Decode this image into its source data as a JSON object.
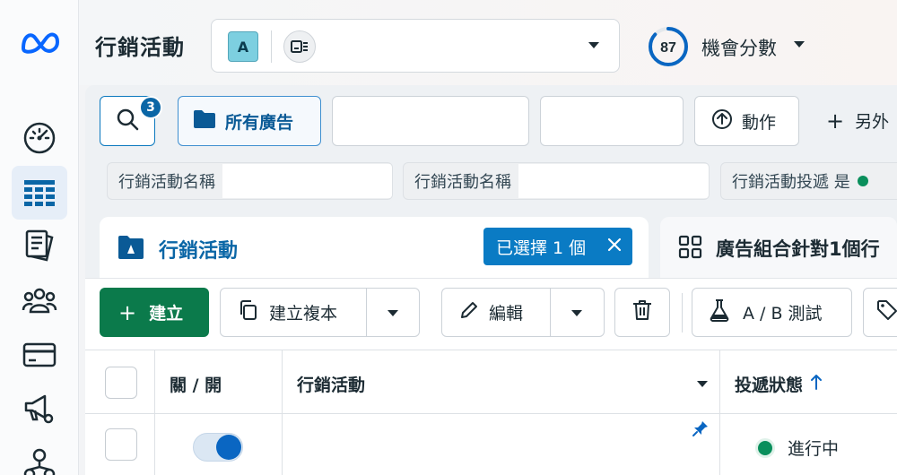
{
  "header": {
    "title": "行銷活動",
    "account_badge": "A",
    "opportunity_score": "87",
    "opportunity_label": "機會分數"
  },
  "toolbar": {
    "search_badge_count": "3",
    "all_ads_label": "所有廣告",
    "action_label": "動作",
    "more_label": "另外"
  },
  "filters": [
    {
      "label": "行銷活動名稱"
    },
    {
      "label": "行銷活動名稱"
    },
    {
      "label": "行銷活動投遞 是"
    }
  ],
  "tabs": {
    "campaign_label": "行銷活動",
    "selected_label": "已選擇 1 個",
    "adset_label": "廣告組合針對1個行"
  },
  "actions": {
    "create": "建立",
    "duplicate": "建立複本",
    "edit": "編輯",
    "ab_test": "A / B 測試"
  },
  "table": {
    "columns": [
      "關 / 開",
      "行銷活動",
      "投遞狀態"
    ],
    "rows": [
      {
        "toggle_on": true,
        "campaign": "",
        "status": "進行中"
      }
    ]
  },
  "colors": {
    "brand_blue": "#0a66a6",
    "create_green": "#0b7a4b",
    "status_green": "#0a8f5c",
    "selected_pill": "#0a7bc4"
  },
  "icons": [
    "meta-logo-icon",
    "dashboard-gauge-icon",
    "table-grid-icon",
    "pages-icon",
    "audience-icon",
    "billing-card-icon",
    "megaphone-gear-icon",
    "hierarchy-icon",
    "placement-icon",
    "search-icon",
    "folder-icon",
    "upload-icon",
    "plus-icon",
    "campaign-flag-icon",
    "close-icon",
    "adset-grid-icon",
    "copy-icon",
    "pencil-icon",
    "trash-icon",
    "flask-icon",
    "tag-icon",
    "pin-icon",
    "sort-arrow-up-icon"
  ]
}
